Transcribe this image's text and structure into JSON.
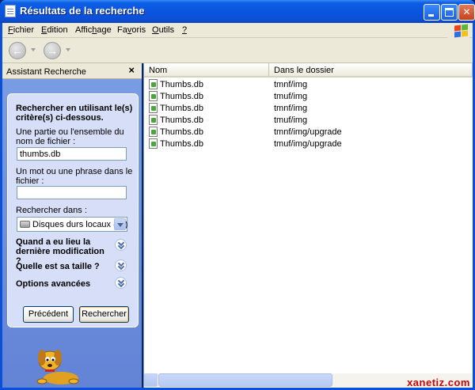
{
  "window": {
    "title": "Résultats de la recherche"
  },
  "menu": {
    "items": [
      {
        "pre": "",
        "u": "F",
        "post": "ichier"
      },
      {
        "pre": "",
        "u": "E",
        "post": "dition"
      },
      {
        "pre": "Affic",
        "u": "h",
        "post": "age"
      },
      {
        "pre": "Fa",
        "u": "v",
        "post": "oris"
      },
      {
        "pre": "",
        "u": "O",
        "post": "utils"
      },
      {
        "pre": "",
        "u": "?",
        "post": ""
      }
    ]
  },
  "icons": {
    "back": "back-arrow-icon",
    "forward": "forward-arrow-icon",
    "window": "search-results-window-icon",
    "logo": "windows-flag-logo",
    "drive": "hard-drive-icon",
    "file": "file-icon",
    "mascot": "search-dog-mascot"
  },
  "search_pane": {
    "title": "Assistant Recherche",
    "close": "×",
    "heading": "Rechercher en utilisant le(s) critère(s) ci-dessous.",
    "name_label": "Une partie ou l'ensemble du nom de fichier :",
    "name_value": "thumbs.db",
    "phrase_label": "Un mot ou une phrase dans le fichier :",
    "phrase_value": "",
    "lookin_label": "Rechercher dans :",
    "lookin_value": "Disques durs locaux (C:)",
    "options": [
      "Quand a eu lieu la dernière modification ?",
      "Quelle est sa taille ?",
      "Options avancées"
    ],
    "back_button": "Précédent",
    "search_button": "Rechercher"
  },
  "results": {
    "columns": [
      "Nom",
      "Dans le dossier"
    ],
    "rows": [
      {
        "name": "Thumbs.db",
        "folder": "tmnf/img"
      },
      {
        "name": "Thumbs.db",
        "folder": "tmuf/img"
      },
      {
        "name": "Thumbs.db",
        "folder": "tmnf/img"
      },
      {
        "name": "Thumbs.db",
        "folder": "tmuf/img"
      },
      {
        "name": "Thumbs.db",
        "folder": "tmnf/img/upgrade"
      },
      {
        "name": "Thumbs.db",
        "folder": "tmuf/img/upgrade"
      }
    ]
  },
  "watermark": "xanetiz.com",
  "colors": {
    "titlebar": "#0a55e0",
    "pane_blue": "#6b8fd8",
    "chrome": "#ece9d8"
  }
}
